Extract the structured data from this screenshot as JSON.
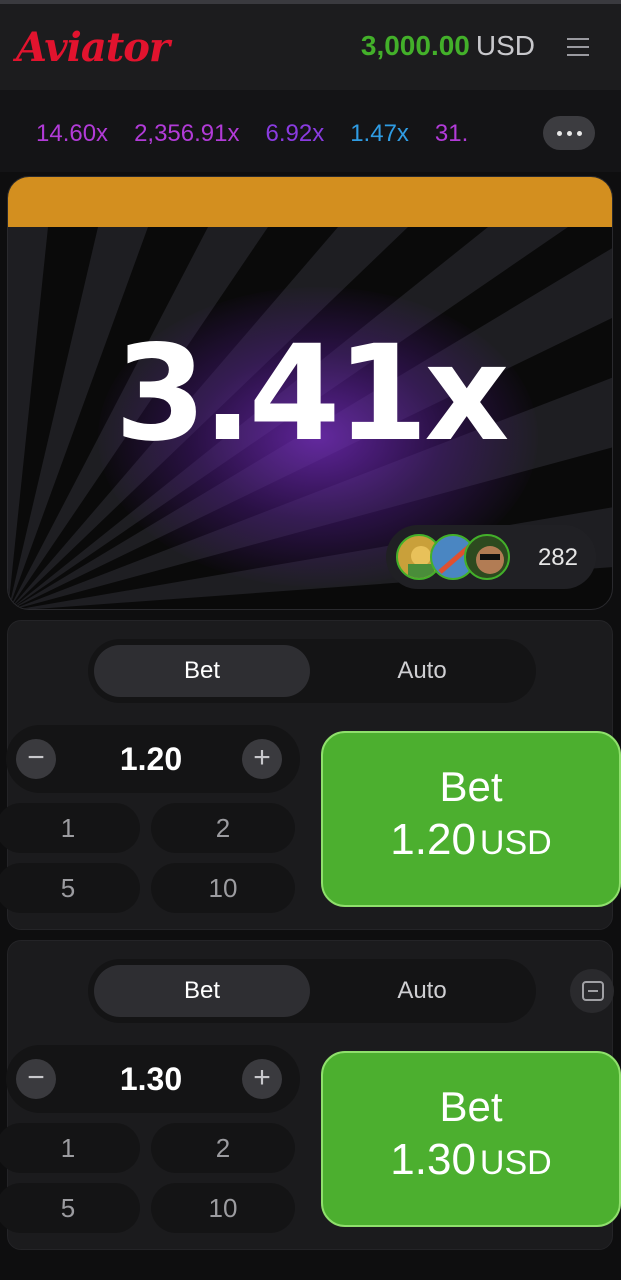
{
  "header": {
    "logo": "Aviator",
    "balance": "3,000.00",
    "currency": "USD"
  },
  "history": {
    "multipliers": [
      {
        "value": "14.60x",
        "color": "#b23bd8"
      },
      {
        "value": "2,356.91x",
        "color": "#b23bd8"
      },
      {
        "value": "6.92x",
        "color": "#8a3be0"
      },
      {
        "value": "1.47x",
        "color": "#2f9ce3"
      },
      {
        "value": "31.",
        "color": "#b23bd8"
      }
    ]
  },
  "game": {
    "multiplier": "3.41x",
    "player_count": "282"
  },
  "panels": [
    {
      "tabs": [
        "Bet",
        "Auto"
      ],
      "amount": "1.20",
      "quick_amounts": [
        "1",
        "2",
        "5",
        "10"
      ],
      "bet_label": "Bet",
      "bet_amount": "1.20",
      "bet_currency": "USD"
    },
    {
      "tabs": [
        "Bet",
        "Auto"
      ],
      "amount": "1.30",
      "quick_amounts": [
        "1",
        "2",
        "5",
        "10"
      ],
      "bet_label": "Bet",
      "bet_amount": "1.30",
      "bet_currency": "USD"
    }
  ],
  "controls": {
    "minus": "−",
    "plus": "+"
  }
}
